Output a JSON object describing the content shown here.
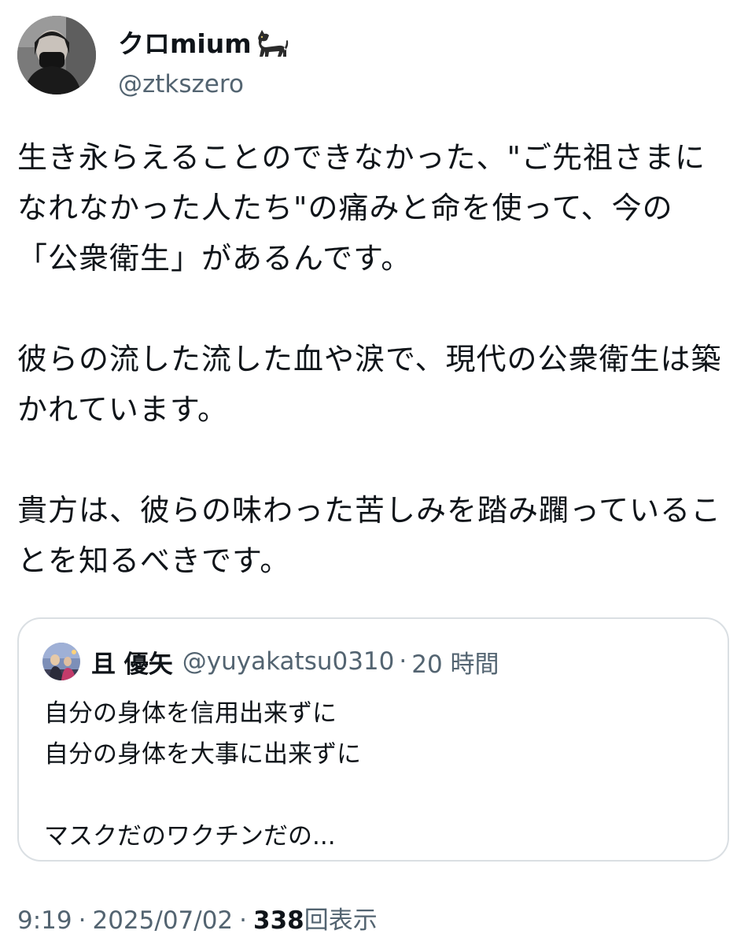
{
  "author": {
    "display_name": "クロmium",
    "name_emoji_icon": "black-cat-icon",
    "handle": "@ztkszero"
  },
  "tweet": {
    "paragraphs": [
      [
        "生き永らえることのできなかった、\"ご先祖さまに",
        "なれなかった人たち\"の痛みと命を使って、今の",
        "「公衆衛生」があるんです。"
      ],
      [
        "彼らの流した流した血や涙で、現代の公衆衛生は築",
        "かれています。"
      ],
      [
        "貴方は、彼らの味わった苦しみを踏み躙っているこ",
        "とを知るべきです。"
      ]
    ]
  },
  "quote": {
    "name": "且 優矢",
    "handle": "@yuyakatsu0310",
    "separator": "·",
    "time": "20 時間",
    "lines": [
      "自分の身体を信用出来ずに",
      "自分の身体を大事に出来ずに",
      "",
      "マスクだのワクチンだの..."
    ]
  },
  "meta": {
    "time": "9:19",
    "separator": "·",
    "date": "2025/07/02",
    "views_count": "338",
    "views_label": "回表示"
  },
  "colors": {
    "text": "#0f1419",
    "secondary": "#536471",
    "border": "#dadfe3",
    "background": "#ffffff"
  }
}
